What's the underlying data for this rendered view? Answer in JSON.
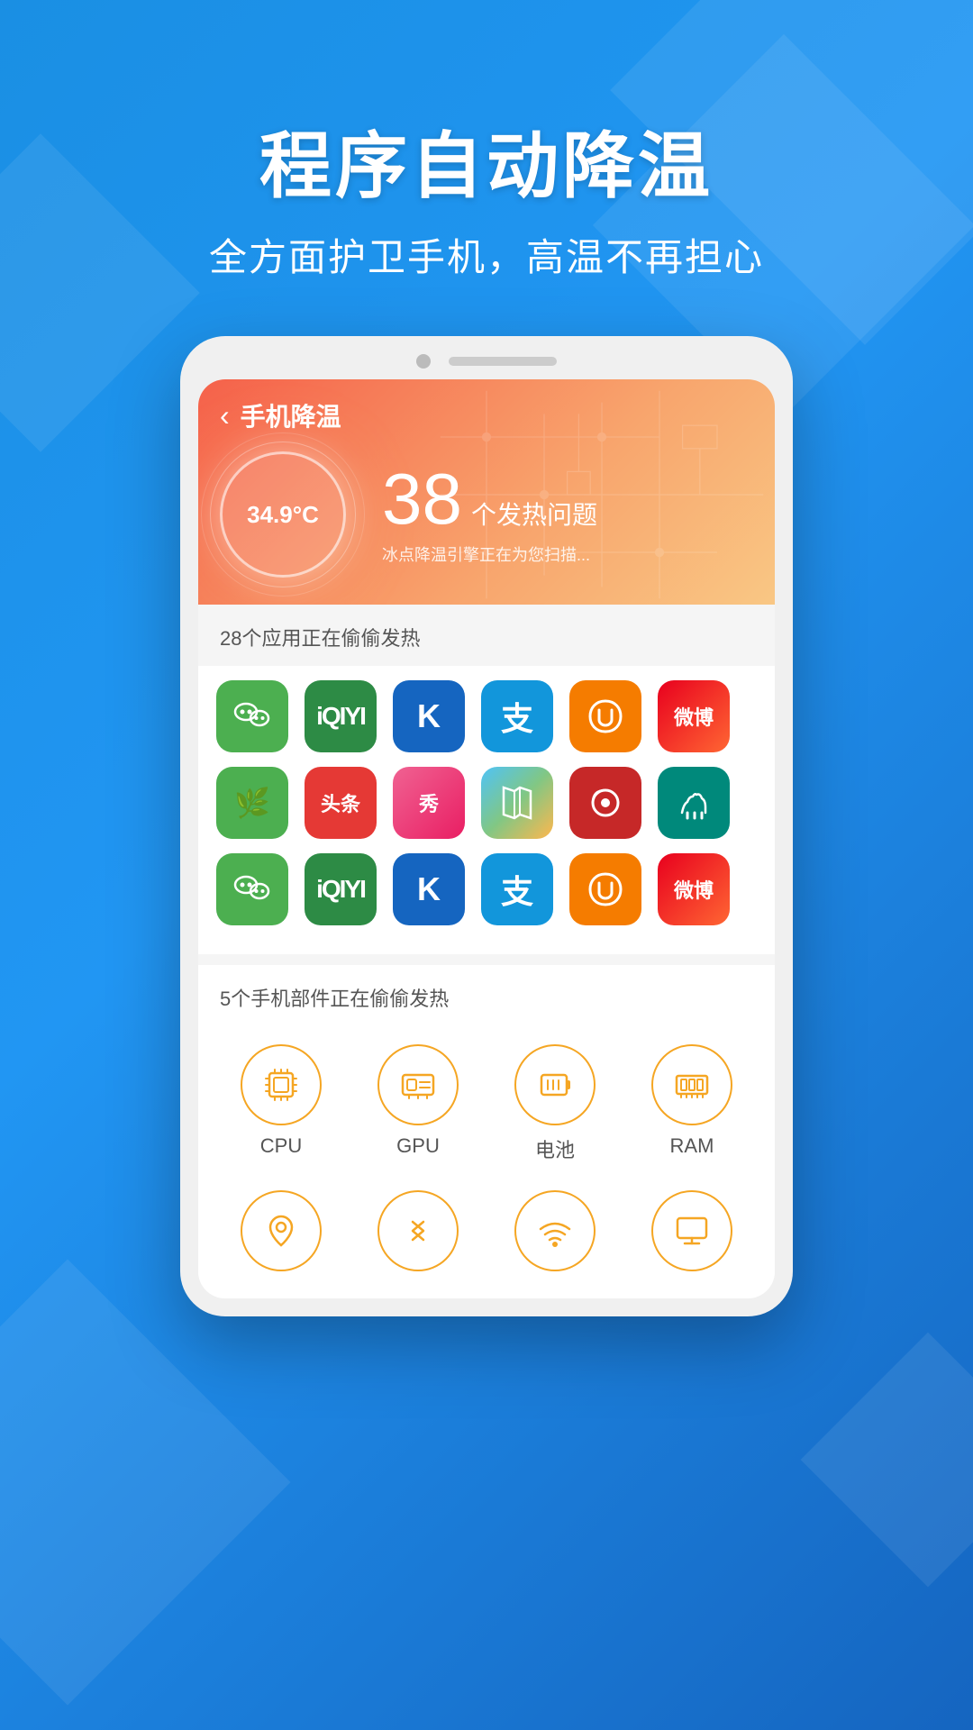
{
  "background": {
    "gradient_start": "#1a8fe3",
    "gradient_end": "#1565c0"
  },
  "header": {
    "main_title": "程序自动降温",
    "sub_title": "全方面护卫手机，高温不再担心"
  },
  "app_screen": {
    "nav": {
      "back_label": "‹",
      "title": "手机降温"
    },
    "temperature": {
      "value": "34.9°C",
      "issue_count": "38",
      "issue_text": "个发热问题",
      "scan_text": "冰点降温引擎正在为您扫描..."
    },
    "apps_section": {
      "label": "28个应用正在偷偷发热",
      "rows": [
        [
          "wechat",
          "iqiyi",
          "kuwo",
          "alipay",
          "uc",
          "weibo"
        ],
        [
          "med",
          "toutiao",
          "xiuxiu",
          "maps",
          "netease",
          "camel"
        ],
        [
          "wechat",
          "iqiyi",
          "kuwo",
          "alipay",
          "uc",
          "weibo"
        ]
      ]
    },
    "hardware_section": {
      "label": "5个手机部件正在偷偷发热",
      "row1": [
        {
          "id": "cpu",
          "label": "CPU",
          "icon": "cpu"
        },
        {
          "id": "gpu",
          "label": "GPU",
          "icon": "gpu"
        },
        {
          "id": "battery",
          "label": "电池",
          "icon": "battery"
        },
        {
          "id": "ram",
          "label": "RAM",
          "icon": "ram"
        }
      ],
      "row2": [
        {
          "id": "location",
          "label": "",
          "icon": "location"
        },
        {
          "id": "bluetooth",
          "label": "",
          "icon": "bluetooth"
        },
        {
          "id": "wifi",
          "label": "",
          "icon": "wifi"
        },
        {
          "id": "screen",
          "label": "",
          "icon": "screen"
        }
      ]
    }
  }
}
